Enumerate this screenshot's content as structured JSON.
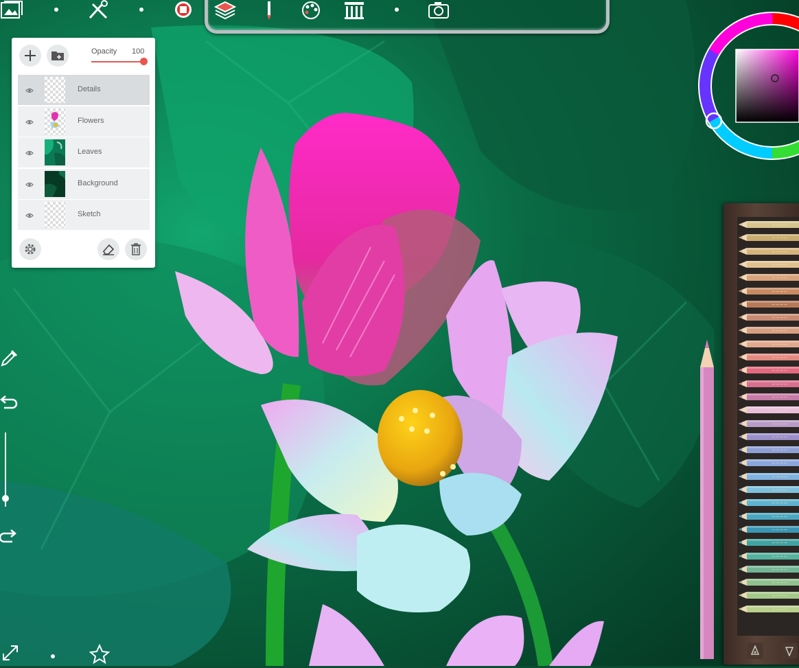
{
  "layers_panel": {
    "opacity_label": "Opacity",
    "opacity_value": "100",
    "opacity_fraction": 1.0,
    "layers": [
      {
        "name": "Details",
        "active": true,
        "thumb": "checker"
      },
      {
        "name": "Flowers",
        "active": false,
        "thumb": "flowers"
      },
      {
        "name": "Leaves",
        "active": false,
        "thumb": "leaves"
      },
      {
        "name": "Background",
        "active": false,
        "thumb": "background"
      },
      {
        "name": "Sketch",
        "active": false,
        "thumb": "checker"
      }
    ]
  },
  "colors": {
    "accent": "#e8564f",
    "current_color": "#ff00dd"
  },
  "icons": {
    "top_toolbar": [
      "gallery-icon",
      "tools-icon",
      "record-icon",
      "layers-icon",
      "brush-icon",
      "palette-icon",
      "library-icon",
      "camera-icon"
    ],
    "side": [
      "eyedropper-icon",
      "undo-icon",
      "redo-icon"
    ],
    "bottom": [
      "resize-icon",
      "favorite-star-icon"
    ]
  },
  "brush_size_fraction": 0.16
}
